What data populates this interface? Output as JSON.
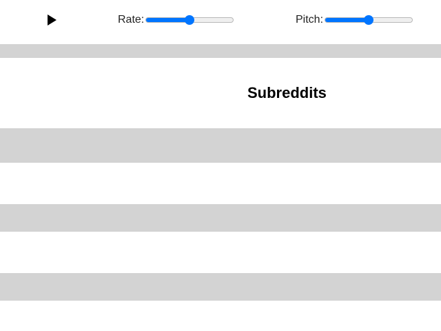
{
  "toolbar": {
    "play_icon": "play-icon",
    "rate": {
      "label": "Rate:",
      "value": 0.5
    },
    "pitch": {
      "label": "Pitch:",
      "value": 0.5
    }
  },
  "main": {
    "heading": "Subreddits"
  },
  "colors": {
    "accent": "#0075ff",
    "band": "#d3d3d3",
    "text": "#000000"
  }
}
